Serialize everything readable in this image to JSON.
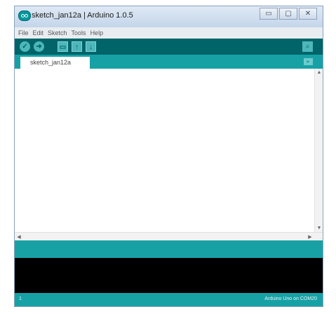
{
  "window": {
    "title": "sketch_jan12a | Arduino 1.0.5",
    "controls": {
      "minimize_glyph": "▭",
      "maximize_glyph": "▢",
      "close_glyph": "✕"
    }
  },
  "menubar": {
    "items": [
      "File",
      "Edit",
      "Sketch",
      "Tools",
      "Help"
    ]
  },
  "toolbar": {
    "buttons": [
      {
        "name": "verify",
        "icon": "check-icon",
        "glyph": "✓"
      },
      {
        "name": "upload",
        "icon": "arrow-right-icon",
        "glyph": "➜"
      },
      {
        "name": "new",
        "icon": "new-file-icon",
        "glyph": "▭"
      },
      {
        "name": "open",
        "icon": "arrow-up-icon",
        "glyph": "↑"
      },
      {
        "name": "save",
        "icon": "arrow-down-icon",
        "glyph": "↓"
      }
    ],
    "serial_monitor_icon": "magnifier-icon",
    "serial_monitor_glyph": "⌕"
  },
  "tabs": {
    "active": "sketch_jan12a",
    "menu_icon": "tab-menu-icon",
    "menu_glyph": "▸"
  },
  "editor": {
    "content": ""
  },
  "status": {
    "line": "1",
    "board": "Arduino Uno on COM20"
  },
  "colors": {
    "toolbar": "#006468",
    "tabbar": "#17a1a5",
    "console": "#000000",
    "button": "#4db7bb"
  }
}
